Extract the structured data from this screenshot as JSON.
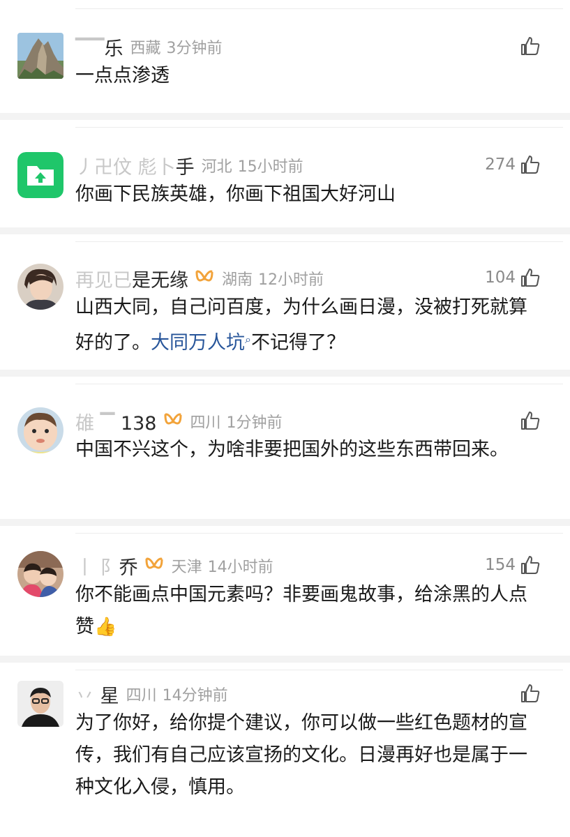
{
  "comments": [
    {
      "name_visible": "乐",
      "name_masked": "▔▔",
      "location": "西藏",
      "time": "3分钟前",
      "likes": "",
      "vip": false,
      "avatar": "mountain-avatar",
      "text": "一点点渗透"
    },
    {
      "name_visible": "手",
      "name_masked": "丿卍伩 彪卜",
      "location": "河北",
      "time": "15小时前",
      "likes": "274",
      "vip": false,
      "avatar": "folder-app-avatar",
      "text": "你画下民族英雄，你画下祖国大好河山"
    },
    {
      "name_visible": "是无缘",
      "name_masked": "再见已",
      "location": "湖南",
      "time": "12小时前",
      "likes": "104",
      "vip": true,
      "avatar": "person-avatar",
      "text_part1": "山西大同，自己问百度，为什么画日漫，没被打死就算好的了。",
      "link": "大同万人坑",
      "text_part2": "不记得了？"
    },
    {
      "name_visible": "138",
      "name_masked": "䧺 ▔",
      "location": "四川",
      "time": "1分钟前",
      "likes": "",
      "vip": true,
      "avatar": "baby-avatar",
      "text": "中国不兴这个，为啥非要把国外的这些东西带回来。"
    },
    {
      "name_visible": "乔",
      "name_masked": "丨 阝",
      "location": "天津",
      "time": "14小时前",
      "likes": "154",
      "vip": true,
      "avatar": "kids-avatar",
      "text": "你不能画点中国元素吗？非要画鬼故事，给涂黑的人点赞",
      "emoji": "👍"
    },
    {
      "name_visible": "星",
      "name_masked": "丷",
      "location": "四川",
      "time": "14分钟前",
      "likes": "",
      "vip": false,
      "avatar": "man-avatar",
      "text": "为了你好，给你提个建议，你可以做一些红色题材的宣传，我们有自己应该宣扬的文化。日漫再好也是属于一种文化入侵，慎用。"
    }
  ],
  "colors": {
    "link": "#27559a",
    "vip": "#f2a33a",
    "meta_gray": "#a0a0a0"
  }
}
